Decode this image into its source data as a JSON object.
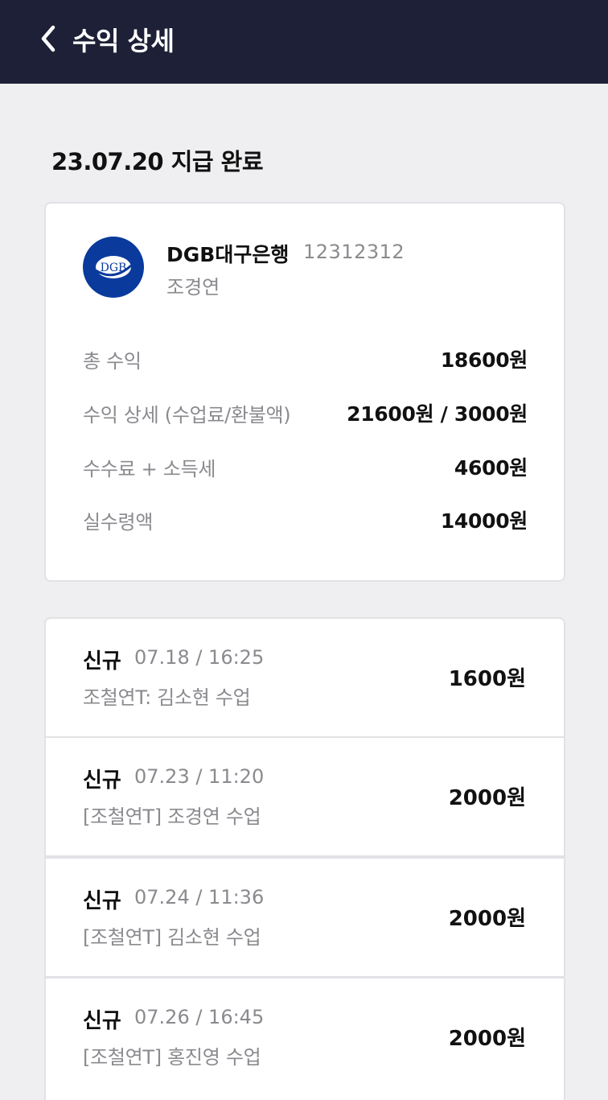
{
  "header": {
    "title": "수익 상세"
  },
  "payout": {
    "date_status": "23.07.20 지급 완료"
  },
  "bank": {
    "logo_text": "DGB",
    "name": "DGB대구은행",
    "account": "12312312",
    "holder": "조경연",
    "logo_color": "#0a3a9c"
  },
  "summary": [
    {
      "label": "총 수익",
      "value": "18600원"
    },
    {
      "label": "수익 상세 (수업료/환불액)",
      "value": "21600원 / 3000원"
    },
    {
      "label": "수수료 + 소득세",
      "value": "4600원"
    },
    {
      "label": "실수령액",
      "value": "14000원"
    }
  ],
  "transactions": [
    {
      "badge": "신규",
      "time": "07.18 / 16:25",
      "desc": "조철연T: 김소현 수업",
      "amount": "1600원"
    },
    {
      "badge": "신규",
      "time": "07.23 / 11:20",
      "desc": "[조철연T] 조경연 수업",
      "amount": "2000원"
    },
    {
      "badge": "신규",
      "time": "07.24 / 11:36",
      "desc": "[조철연T] 김소현 수업",
      "amount": "2000원"
    },
    {
      "badge": "신규",
      "time": "07.26 / 16:45",
      "desc": "[조철연T] 홍진영 수업",
      "amount": "2000원"
    }
  ],
  "colors": {
    "header_bg": "#1d2036",
    "page_bg": "#efeff1",
    "muted_text": "#8a8a8f"
  }
}
